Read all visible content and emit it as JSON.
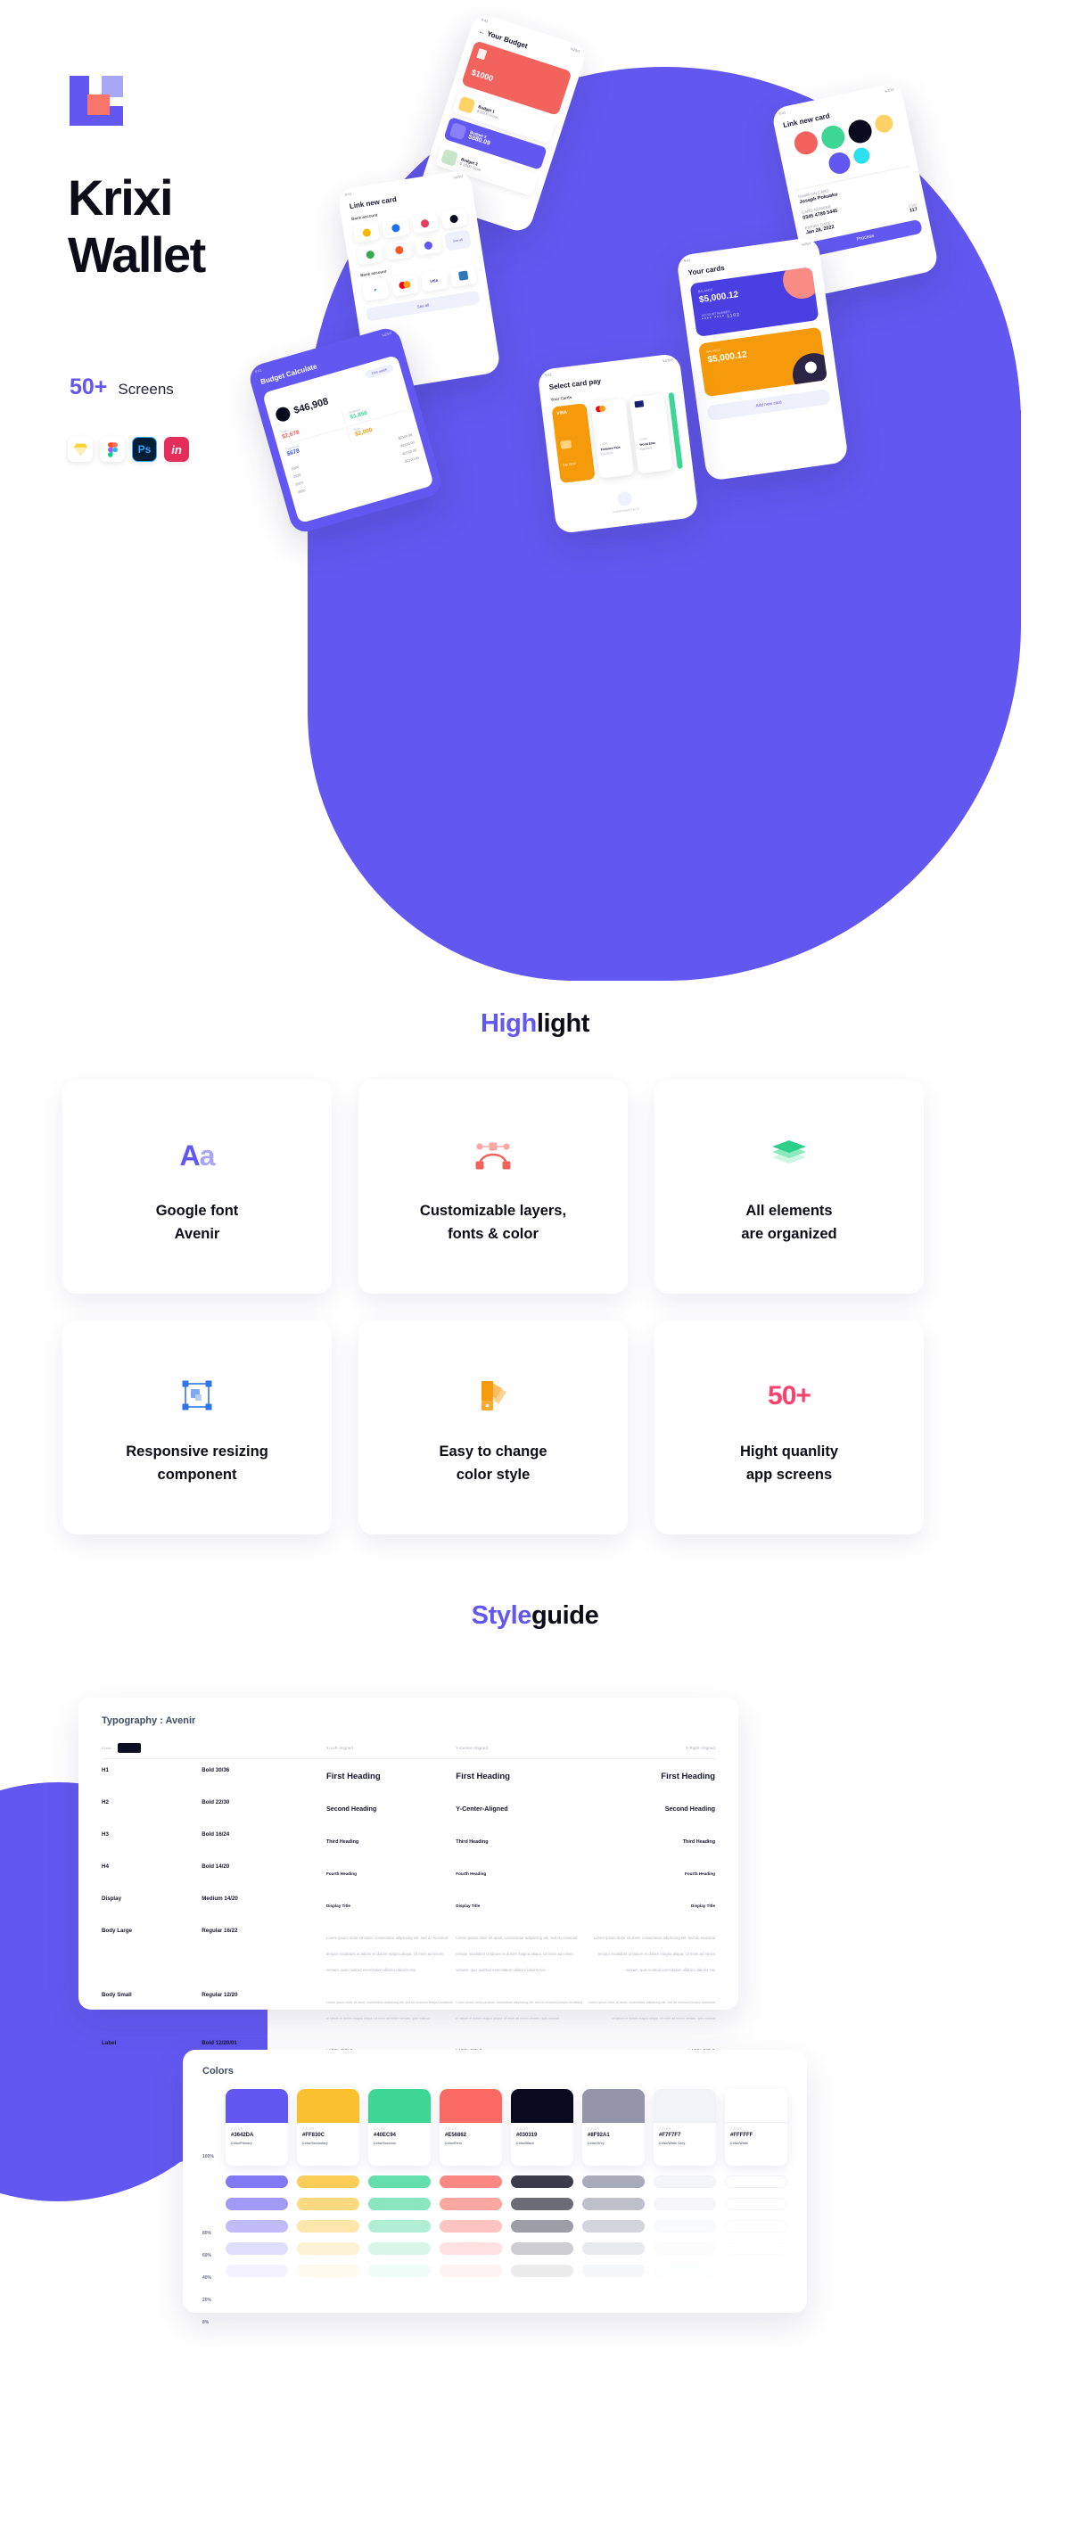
{
  "hero": {
    "logo_name": "krixi-logo",
    "title_line1": "Krixi",
    "title_line2": "Wallet",
    "screens_count": "50+",
    "screens_label": "Screens",
    "tools": [
      {
        "name": "sketch",
        "label": "◇"
      },
      {
        "name": "figma",
        "label": "⚑"
      },
      {
        "name": "photoshop",
        "label": "Ps"
      },
      {
        "name": "invision",
        "label": "in"
      }
    ],
    "phones": [
      {
        "id": "budget",
        "title": "← Your Budget",
        "card_amount": "$1000",
        "items": [
          {
            "name": "Budget 1",
            "value": "$ 5000 Goal"
          },
          {
            "name": "Budget 2",
            "value": "$880.09"
          },
          {
            "name": "Budget 3",
            "value": "$ 1000 Goal"
          }
        ]
      },
      {
        "id": "link-new-card-right",
        "title": "Link new card",
        "fields": [
          {
            "label": "NAME ON CARD",
            "value": "Joseph Pokuaku"
          },
          {
            "label": "CARD NUMBER",
            "value": "0345 4789 5445"
          },
          {
            "label": "EXPIRY DATE",
            "value": "Jan 28, 2022"
          },
          {
            "label": "CVV",
            "value": "117"
          }
        ],
        "button": "Process"
      },
      {
        "id": "link-new-card-left",
        "title": "Link new card",
        "section1": "Bank account",
        "section2": "Bank account",
        "see_all": "See all",
        "methods": [
          "Paypal",
          "Mastercard",
          "Visa",
          "Amex"
        ]
      },
      {
        "id": "your-cards",
        "title": "Your cards",
        "card_label": "BALANCE",
        "card_balance": "$5,000.12",
        "card_number_label": "ACCOUNT NUMBER",
        "card_number": "**** **** 1102",
        "card2_balance": "$5,000.12",
        "add_new": "Add new card"
      },
      {
        "id": "budget-calculate",
        "title": "Budget Calculate",
        "range": "This week",
        "total_big": "$46,908",
        "stats": [
          {
            "label": "Subtotal",
            "value": "$1,856"
          },
          {
            "label": "Total",
            "value": "$2,678"
          },
          {
            "label": "Sum",
            "value": "$2,000"
          },
          {
            "label": "Payments",
            "value": "$678"
          }
        ],
        "rows": [
          "-$2100.00",
          "-$2100.00",
          "-$2100.00",
          "-$2100.00"
        ]
      },
      {
        "id": "select-card-pay",
        "title": "Select card pay",
        "subtitle": "Your Cards",
        "cards": [
          "VISA",
          "Frelance Plus Exp 01/22",
          "World Elite Exp 01/22"
        ],
        "footer": "Include Apple Pay ID"
      }
    ]
  },
  "highlight": {
    "title_accent": "High",
    "title_dark": "light",
    "cards": [
      {
        "icon": "aa-icon",
        "label": "Google font\nAvenir"
      },
      {
        "icon": "bezier-icon",
        "label": "Customizable layers,\nfonts & color"
      },
      {
        "icon": "layers-icon",
        "label": "All elements\nare organized"
      },
      {
        "icon": "resize-icon",
        "label": "Responsive resizing\ncomponent"
      },
      {
        "icon": "palette-icon",
        "label": "Easy to change\ncolor style"
      },
      {
        "icon": "fifty-plus-icon",
        "label": "Hight quanlity\napp screens"
      }
    ],
    "aa_upper": "A",
    "aa_lower": "a",
    "fifty": "50+"
  },
  "styleguide": {
    "title_accent": "Style",
    "title_dark": "guide",
    "typography": {
      "heading": "Typography : Avenir",
      "dark_label": "/Dark/",
      "columns": [
        "",
        "",
        "X-Left-Aligned",
        "Y-Center-Aligned",
        "X-Right-Aligned"
      ],
      "rows": [
        {
          "name": "H1",
          "spec": "Bold 30/36",
          "c1": "First Heading",
          "c2": "First Heading",
          "c3": "First Heading",
          "style": "h1"
        },
        {
          "name": "H2",
          "spec": "Bold 22/30",
          "c1": "Second Heading",
          "c2": "Y-Center-Aligned",
          "c3": "Second Heading",
          "style": "h2"
        },
        {
          "name": "H3",
          "spec": "Bold 16/24",
          "c1": "Third Heading",
          "c2": "Third Heading",
          "c3": "Third Heading",
          "style": "h3"
        },
        {
          "name": "H4",
          "spec": "Bold 14/20",
          "c1": "Fourth Heading",
          "c2": "Fourth Heading",
          "c3": "Fourth Heading",
          "style": "h4"
        },
        {
          "name": "Display",
          "spec": "Medium 14/20",
          "c1": "Display Title",
          "c2": "Display Title",
          "c3": "Display Title",
          "style": "dp"
        },
        {
          "name": "Body Large",
          "spec": "Regular 16/22",
          "c1": "Lorem ipsum dolor sit amet, consectetur adipiscing elit, sed do eiusmod tempor incididunt ut labore et dolore magna aliqua. Ut enim ad minim veniam, quis nostrud exercitation ullamco laboris nisi",
          "c2": "Lorem ipsum dolor sit amet, consectetur adipiscing elit, sed do eiusmod tempor incididunt ut labore et dolore magna aliqua. Ut enim ad minim veniam, quis nostrud exercitation ullamco laboris nisi",
          "c3": "Lorem ipsum dolor sit amet, consectetur adipiscing elit, sed do eiusmod tempor incididunt ut labore et dolore magna aliqua. Ut enim ad minim veniam, quis nostrud exercitation ullamco laboris nisi",
          "style": "bl"
        },
        {
          "name": "Body Small",
          "spec": "Regular 12/20",
          "c1": "Lorem ipsum dolor sit amet, consectetur adipiscing elit, sed do eiusmod tempor incididunt ut labore et dolore magna aliqua. Ut enim ad minim veniam, quis nostrud",
          "c2": "Lorem ipsum dolor sit amet, consectetur adipiscing elit, sed do eiusmod tempor incididunt ut labore et dolore magna aliqua. Ut enim ad minim veniam, quis nostrud",
          "c3": "Lorem ipsum dolor sit amet, consectetur adipiscing elit, sed do eiusmod tempor incididunt ut labore et dolore magna aliqua. Ut enim ad minim veniam, quis nostrud",
          "style": "bs"
        },
        {
          "name": "Label",
          "spec": "Bold 12/20/01",
          "c1": "LABEL TITLE",
          "c2": "LABEL TITLE",
          "c3": "LABEL TITLE",
          "style": "lb"
        }
      ]
    },
    "colors": {
      "heading": "Colors",
      "color_label": "COLOR",
      "percents": [
        "100%",
        "80%",
        "60%",
        "40%",
        "20%",
        "8%"
      ],
      "swatches": [
        {
          "hex": "#3642DA",
          "name": "Color/Primary",
          "display": "#6257F0"
        },
        {
          "hex": "#FF830C",
          "name": "Color/Secondary",
          "display": "#FBC02D"
        },
        {
          "hex": "#40EC94",
          "name": "Color/Success",
          "display": "#3DD695"
        },
        {
          "hex": "#E56862",
          "name": "Color/Error",
          "display": "#F86A63"
        },
        {
          "hex": "#030319",
          "name": "Color/Black",
          "display": "#0A0A1E"
        },
        {
          "hex": "#8F92A1",
          "name": "Color/Grey",
          "display": "#9296A8"
        },
        {
          "hex": "#F7F7F7",
          "name": "Color/White Grey",
          "display": "#F2F3F6"
        },
        {
          "hex": "#FFFFFF",
          "name": "Color/White",
          "display": "#FFFFFF"
        }
      ]
    }
  }
}
